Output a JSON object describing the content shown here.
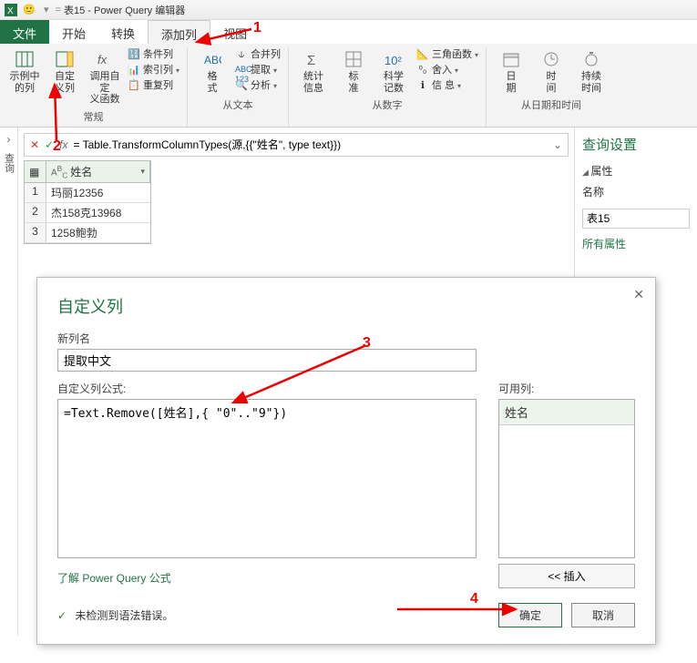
{
  "title_bar": {
    "app_icon": "excel-icon",
    "smiley": "🙂",
    "title": "表15 - Power Query 编辑器"
  },
  "tabs": {
    "file": "文件",
    "home": "开始",
    "transform": "转换",
    "add_col": "添加列",
    "view": "视图"
  },
  "ribbon": {
    "g1": {
      "example_col_1": "示例中",
      "example_col_2": "的列",
      "custom_col_1": "自定",
      "custom_col_2": "义列",
      "custom_fn_1": "调用自定",
      "custom_fn_2": "义函数",
      "cond_col": "条件列",
      "index_col": "索引列",
      "dup_col": "重复列",
      "label": "常规"
    },
    "g2": {
      "format_1": "格",
      "format_2": "式",
      "merge": "合并列",
      "extract": "提取",
      "parse": "分析",
      "label": "从文本"
    },
    "g3": {
      "stats_1": "统计",
      "stats_2": "信息",
      "std_1": "标",
      "std_2": "准",
      "sci_1": "科学",
      "sci_2": "记数",
      "trig": "三角函数",
      "round": "舍入",
      "info_1": "信",
      "info_2": "息",
      "label": "从数字"
    },
    "g4": {
      "date_1": "日",
      "date_2": "期",
      "time_1": "时",
      "time_2": "间",
      "dur_1": "持续",
      "dur_2": "时间",
      "label": "从日期和时间"
    }
  },
  "formula_bar": {
    "formula": "= Table.TransformColumnTypes(源,{{\"姓名\", type text}})"
  },
  "table": {
    "col_header": "姓名",
    "rows": [
      {
        "idx": "1",
        "val": "玛丽12356"
      },
      {
        "idx": "2",
        "val": "杰158克13968"
      },
      {
        "idx": "3",
        "val": "1258鲍勃"
      }
    ]
  },
  "right_panel": {
    "title": "查询设置",
    "props_head": "属性",
    "name_label": "名称",
    "name_value": "表15",
    "all_props": "所有属性"
  },
  "dialog": {
    "title": "自定义列",
    "new_col_label": "新列名",
    "new_col_value": "提取中文",
    "formula_label": "自定义列公式:",
    "formula_value": "=Text.Remove([姓名],{ \"0\"..\"9\"})",
    "avail_label": "可用列:",
    "avail_item": "姓名",
    "insert_btn": "<< 插入",
    "learn_link": "了解 Power Query 公式",
    "status": "未检测到语法错误。",
    "ok": "确定",
    "cancel": "取消"
  },
  "annotations": {
    "n1": "1",
    "n2": "2",
    "n3": "3",
    "n4": "4"
  },
  "sidebar": {
    "label": "查询"
  }
}
